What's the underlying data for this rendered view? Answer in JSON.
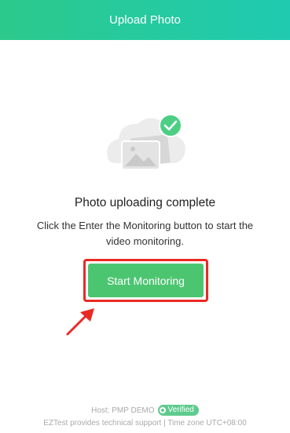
{
  "header": {
    "title": "Upload Photo"
  },
  "illustration": {
    "icons": [
      "cloud-icon",
      "photo-icon",
      "check-circle-icon"
    ]
  },
  "status": {
    "title": "Photo uploading complete",
    "description": "Click the Enter the Monitoring button to start the video monitoring."
  },
  "actions": {
    "start_label": "Start Monitoring"
  },
  "annotation": {
    "icon": "red-arrow-icon",
    "highlight_color": "#ea2a24"
  },
  "footer": {
    "host": "Host: PMP DEMO",
    "verified": "Verified",
    "support": "EZTest provides technical support | Time zone  UTC+08:00"
  },
  "colors": {
    "header_start": "#2cc98c",
    "header_end": "#1fcab0",
    "button": "#4cc571",
    "badge": "#5ecb8e"
  }
}
